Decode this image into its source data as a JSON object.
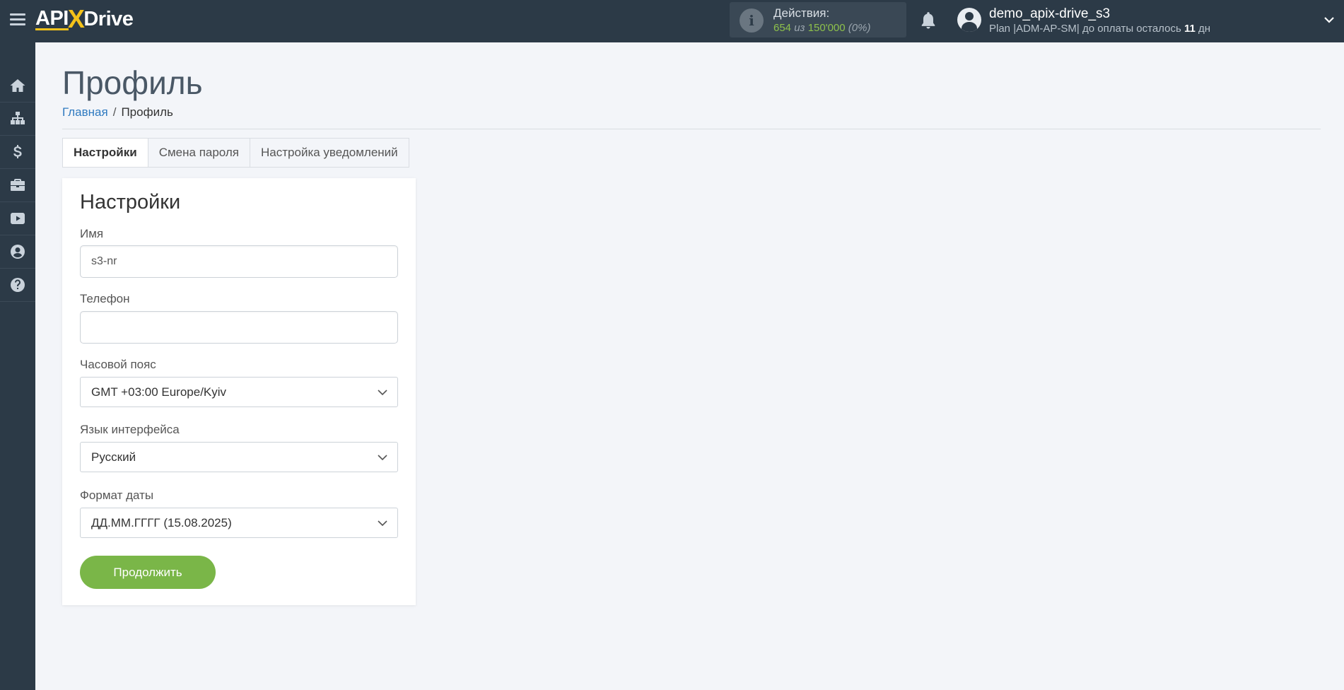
{
  "header": {
    "logo_left": "API",
    "logo_x": "X",
    "logo_right": "Drive",
    "actions_label": "Действия:",
    "actions_used": "654",
    "actions_of": "из",
    "actions_total": "150'000",
    "actions_percent": "(0%)",
    "user_name": "demo_apix-drive_s3",
    "user_plan_prefix": "Plan |ADM-AP-SM| до оплаты осталось",
    "user_plan_days": "11",
    "user_plan_suffix": "дн"
  },
  "sidebar": {
    "items": [
      "home-icon",
      "sitemap-icon",
      "dollar-icon",
      "briefcase-icon",
      "youtube-icon",
      "user-circle-icon",
      "question-circle-icon"
    ]
  },
  "page": {
    "title": "Профиль",
    "breadcrumb_home": "Главная",
    "breadcrumb_sep": "/",
    "breadcrumb_current": "Профиль"
  },
  "tabs": {
    "settings": "Настройки",
    "password": "Смена пароля",
    "notifications": "Настройка уведомлений"
  },
  "form": {
    "title": "Настройки",
    "name_label": "Имя",
    "name_value": "s3-nr",
    "phone_label": "Телефон",
    "phone_value": "",
    "timezone_label": "Часовой пояс",
    "timezone_value": "GMT +03:00 Europe/Kyiv",
    "language_label": "Язык интерфейса",
    "language_value": "Русский",
    "date_format_label": "Формат даты",
    "date_format_value": "ДД.ММ.ГГГГ (15.08.2025)",
    "submit_label": "Продолжить"
  },
  "colors": {
    "topbar": "#2c3a47",
    "accent_green": "#7ab648",
    "link_blue": "#2f7ac0",
    "logo_yellow": "#f4c21a"
  }
}
